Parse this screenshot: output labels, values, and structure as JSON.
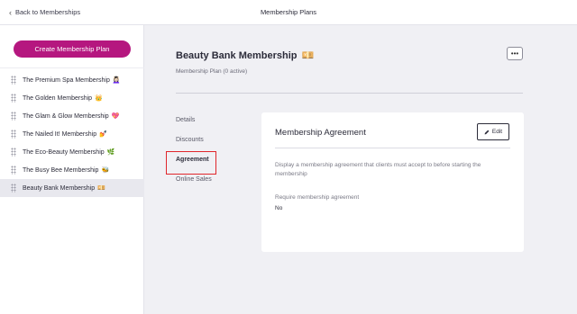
{
  "header": {
    "back_label": "Back to Memberships",
    "title": "Membership Plans"
  },
  "sidebar": {
    "create_button": "Create Membership Plan",
    "plans": [
      {
        "label": "The Premium Spa Membership",
        "emoji": "💆🏻‍♀️",
        "active": false
      },
      {
        "label": "The Golden Membership",
        "emoji": "👑",
        "active": false
      },
      {
        "label": "The Glam & Glow Membership",
        "emoji": "💖",
        "active": false
      },
      {
        "label": "The Nailed It! Membership",
        "emoji": "💅",
        "active": false
      },
      {
        "label": "The Eco-Beauty Membership",
        "emoji": "🌿",
        "active": false
      },
      {
        "label": "The Busy Bee Membership",
        "emoji": "🐝",
        "active": false
      },
      {
        "label": "Beauty Bank Membership",
        "emoji": "💴",
        "active": true
      }
    ]
  },
  "main": {
    "plan_name": "Beauty Bank Membership",
    "plan_emoji": "💴",
    "plan_subtitle": "Membership Plan (0 active)",
    "more_label": "•••",
    "nav": [
      {
        "label": "Details",
        "active": false
      },
      {
        "label": "Discounts",
        "active": false
      },
      {
        "label": "Agreement",
        "active": true
      },
      {
        "label": "Online Sales",
        "active": false
      }
    ],
    "card": {
      "title": "Membership Agreement",
      "edit_label": "Edit",
      "description": "Display a membership agreement that clients must accept to before starting the membership",
      "field_label": "Require membership agreement",
      "field_value": "No"
    }
  },
  "colors": {
    "accent": "#b5177f",
    "highlight_outline": "#e0262b"
  }
}
